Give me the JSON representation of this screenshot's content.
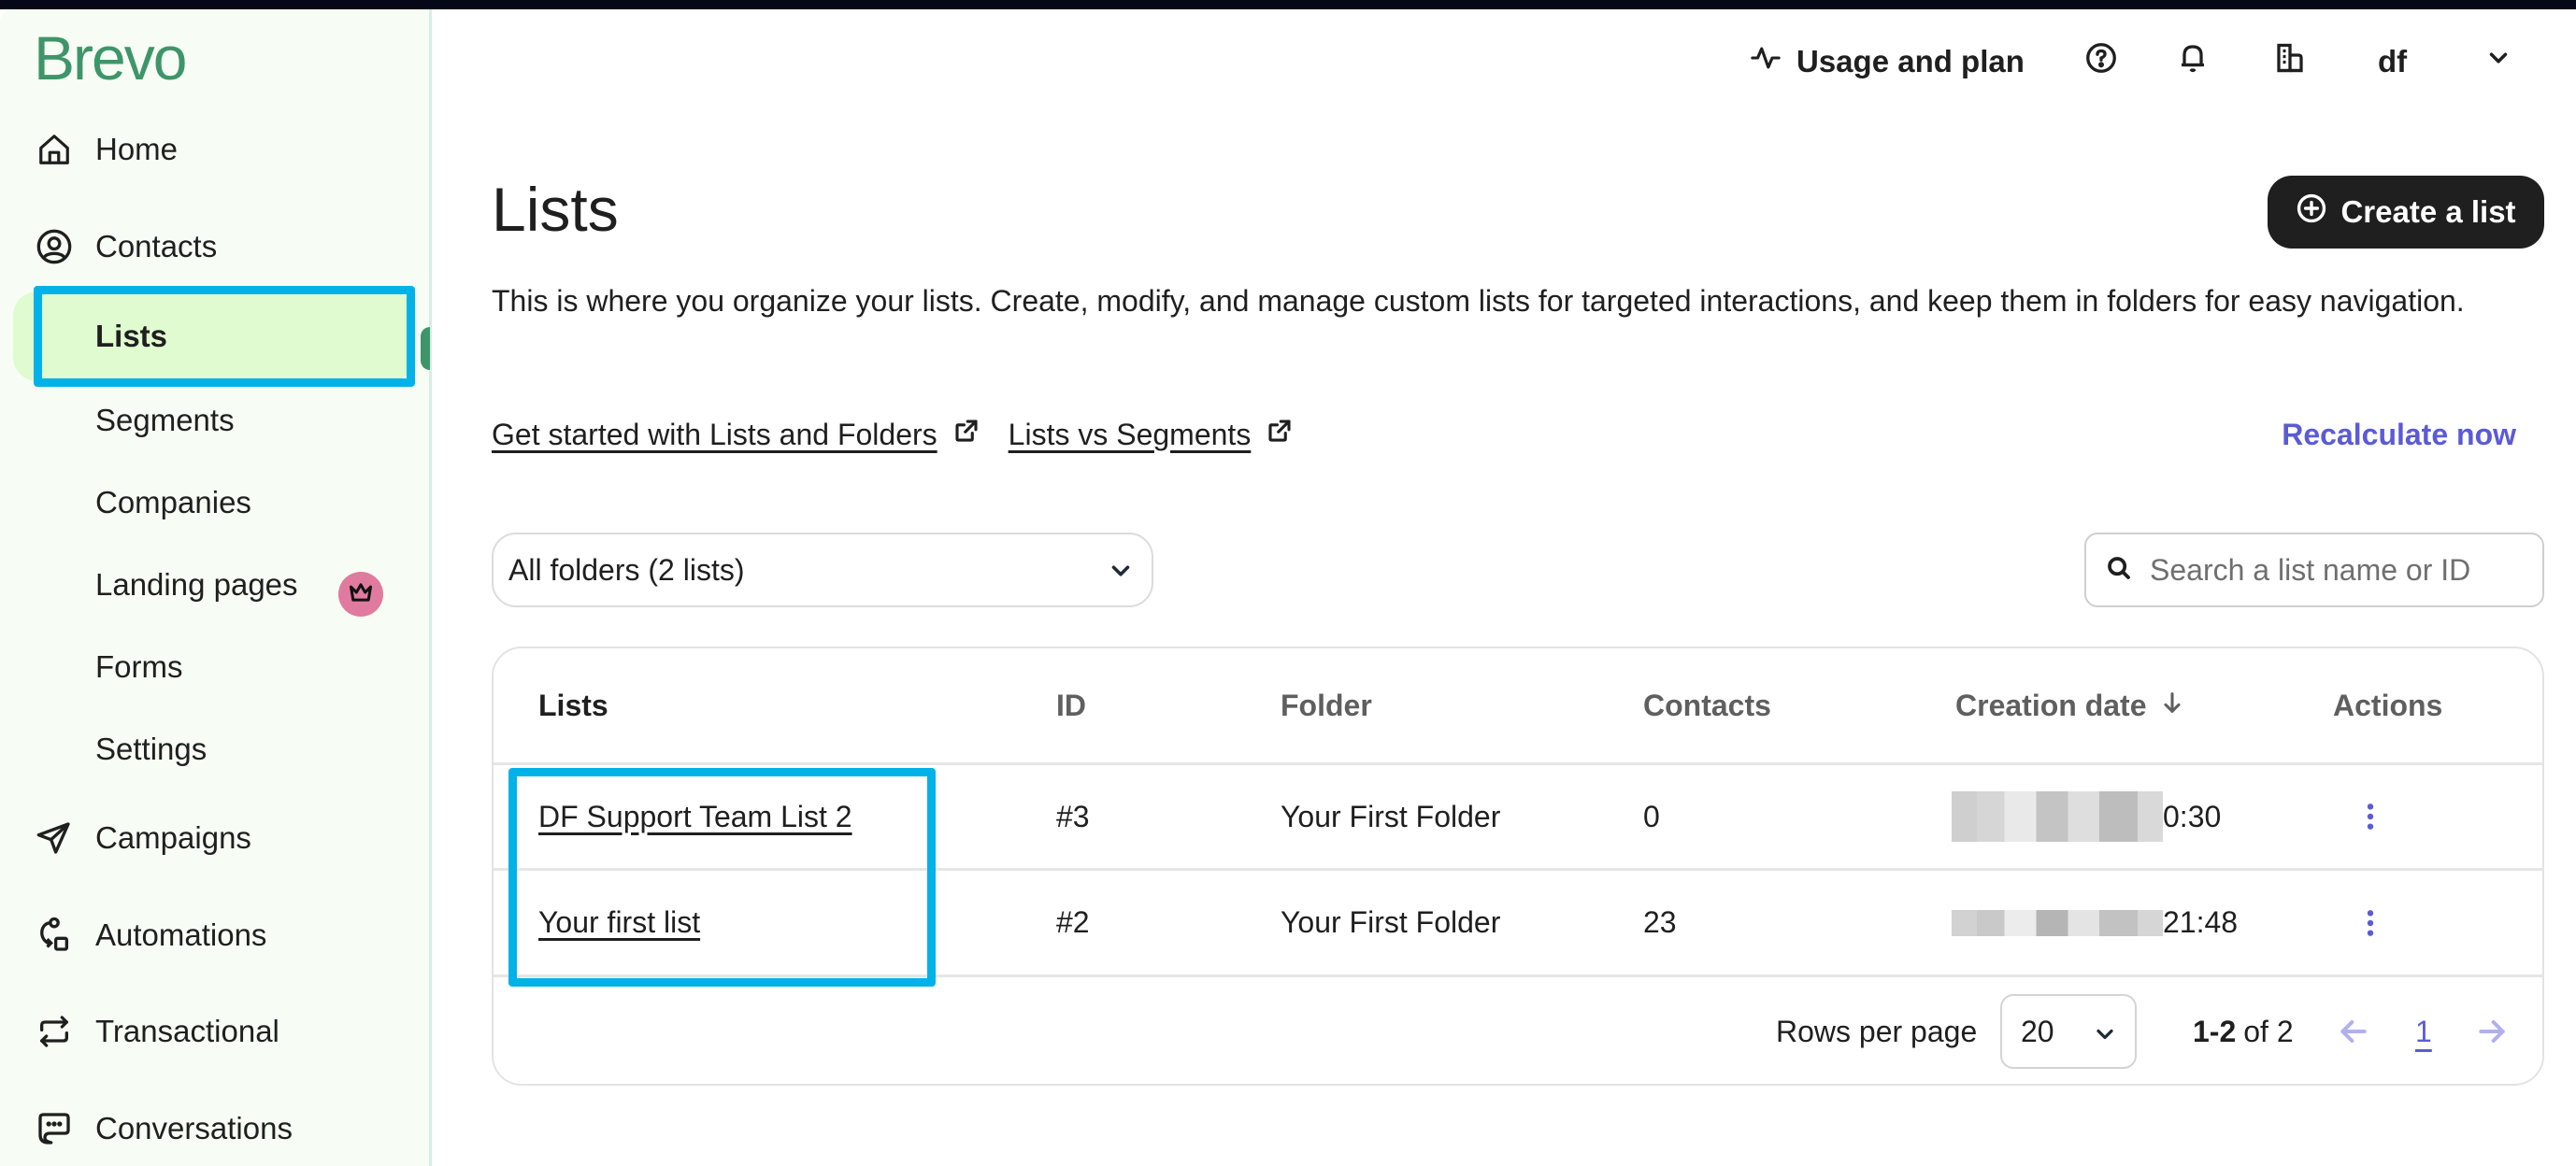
{
  "app": {
    "logo": "Brevo",
    "brand_color": "#3f956a",
    "accent_color": "#5b5bd6",
    "highlight_color": "#00b2e8"
  },
  "header": {
    "usage_label": "Usage and plan",
    "help_icon": "help-circle-icon",
    "notifications_icon": "bell-icon",
    "organization_icon": "building-icon",
    "account_label": "df",
    "account_chevron": "chevron-down-icon"
  },
  "sidebar": {
    "items": [
      {
        "label": "Home",
        "icon": "home-icon"
      },
      {
        "label": "Contacts",
        "icon": "user-circle-icon"
      },
      {
        "label": "Lists",
        "active": true
      },
      {
        "label": "Segments"
      },
      {
        "label": "Companies"
      },
      {
        "label": "Landing pages",
        "badge": "crown-icon"
      },
      {
        "label": "Forms"
      },
      {
        "label": "Settings"
      },
      {
        "label": "Campaigns",
        "icon": "paper-plane-icon"
      },
      {
        "label": "Automations",
        "icon": "automation-flow-icon"
      },
      {
        "label": "Transactional",
        "icon": "arrows-exchange-icon"
      },
      {
        "label": "Conversations",
        "icon": "chat-bubble-icon"
      }
    ]
  },
  "page": {
    "title": "Lists",
    "create_button": "Create a list",
    "description": "This is where you organize your lists. Create, modify, and manage custom lists for targeted interactions, and keep them in folders for easy navigation.",
    "links": [
      {
        "label": "Get started with Lists and Folders",
        "icon": "external-link-icon"
      },
      {
        "label": "Lists vs Segments",
        "icon": "external-link-icon"
      }
    ],
    "recalculate": "Recalculate now",
    "folder_select": {
      "value": "All folders (2 lists)"
    },
    "search": {
      "placeholder": "Search a list name or ID",
      "value": ""
    }
  },
  "table": {
    "columns": [
      "Lists",
      "ID",
      "Folder",
      "Contacts",
      "Creation date",
      "Actions"
    ],
    "sort": {
      "column": "Creation date",
      "direction": "descending"
    },
    "rows": [
      {
        "name": "DF Support Team List 2",
        "id": "#3",
        "folder": "Your First Folder",
        "contacts": "0",
        "creation_date_visible": "0:30",
        "creation_date_redacted": true
      },
      {
        "name": "Your first list",
        "id": "#2",
        "folder": "Your First Folder",
        "contacts": "23",
        "creation_date_visible": "21:48",
        "creation_date_redacted": true
      }
    ],
    "pagination": {
      "rows_per_page_label": "Rows per page",
      "rows_per_page": "20",
      "range_bold": "1-2",
      "range_rest": "of 2",
      "current_page": "1"
    }
  }
}
